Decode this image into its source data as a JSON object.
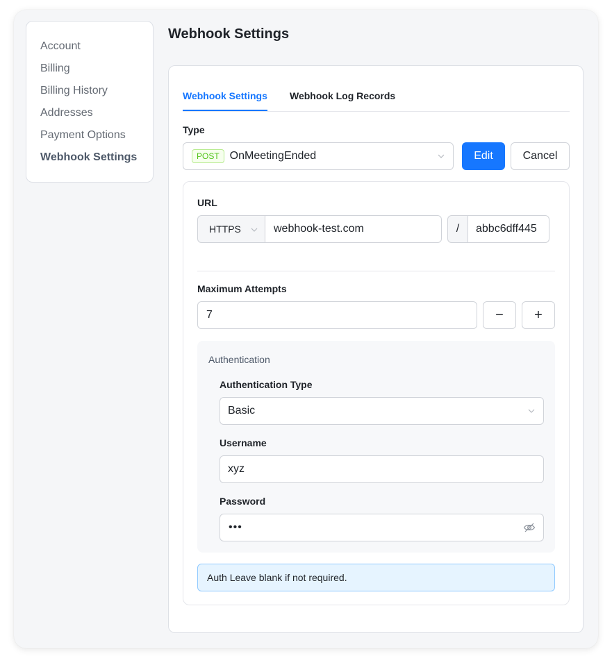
{
  "sidebar": {
    "items": [
      {
        "label": "Account"
      },
      {
        "label": "Billing"
      },
      {
        "label": "Billing History"
      },
      {
        "label": "Addresses"
      },
      {
        "label": "Payment Options"
      },
      {
        "label": "Webhook Settings"
      }
    ]
  },
  "page": {
    "title": "Webhook Settings"
  },
  "tabs": [
    {
      "label": "Webhook Settings"
    },
    {
      "label": "Webhook Log Records"
    }
  ],
  "type_field": {
    "label": "Type",
    "method_badge": "POST",
    "value": "OnMeetingEnded",
    "edit_label": "Edit",
    "cancel_label": "Cancel"
  },
  "url_field": {
    "label": "URL",
    "protocol": "HTTPS",
    "host": "webhook-test.com",
    "separator": "/",
    "path": "abbc6dff445"
  },
  "attempts": {
    "label": "Maximum Attempts",
    "value": "7",
    "decrement": "−",
    "increment": "+"
  },
  "authentication": {
    "section_title": "Authentication",
    "type_label": "Authentication Type",
    "type_value": "Basic",
    "username_label": "Username",
    "username_value": "xyz",
    "password_label": "Password",
    "password_value": "•••"
  },
  "alert": {
    "text": "Auth Leave blank if not required."
  },
  "colors": {
    "primary": "#1677ff",
    "badge_green": "#52c41a",
    "alert_bg": "#e6f4ff"
  }
}
